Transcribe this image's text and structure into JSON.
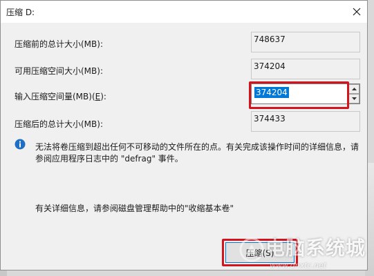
{
  "window": {
    "title": "压缩 D:"
  },
  "fields": {
    "total_before": {
      "label": "压缩前的总计大小(MB):",
      "value": "748637"
    },
    "available": {
      "label": "可用压缩空间大小(MB):",
      "value": "374204"
    },
    "amount": {
      "label_pre": "输入压缩空间量(MB)(",
      "label_key": "E",
      "label_post": "):",
      "value": "374204"
    },
    "total_after": {
      "label": "压缩后的总计大小(MB):",
      "value": "374433"
    }
  },
  "info": {
    "line1": "无法将卷压缩到超出任何不可移动的文件所在的点。有关完成该操作时间的详细信息，请",
    "line2": "参阅应用程序日志中的 \"defrag\" 事件。",
    "help": "有关详细信息，请参阅磁盘管理帮助中的\"收缩基本卷\""
  },
  "buttons": {
    "ok_label": "压缩(S)"
  },
  "background": {
    "char1": "本",
    "char2": "几"
  },
  "watermark": {
    "text": "电脑系统城",
    "url": "www.dnxtc.net"
  },
  "colors": {
    "highlight_red": "#d3141c",
    "selection_blue": "#0078d7"
  }
}
